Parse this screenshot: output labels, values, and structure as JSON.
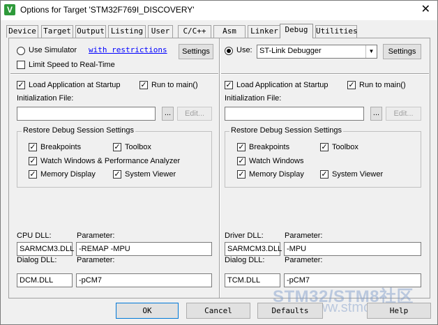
{
  "window": {
    "title": "Options for Target 'STM32F769I_DISCOVERY'",
    "close_glyph": "✕",
    "app_icon_glyph": "V"
  },
  "tabs": [
    {
      "label": "Device"
    },
    {
      "label": "Target"
    },
    {
      "label": "Output"
    },
    {
      "label": "Listing"
    },
    {
      "label": "User"
    },
    {
      "label": "C/C++"
    },
    {
      "label": "Asm"
    },
    {
      "label": "Linker"
    },
    {
      "label": "Debug",
      "active": true
    },
    {
      "label": "Utilities"
    }
  ],
  "left": {
    "use_simulator_label": "Use Simulator",
    "with_restrictions_link": "with restrictions",
    "settings_label": "Settings",
    "limit_speed_label": "Limit Speed to Real-Time",
    "load_app_label": "Load Application at Startup",
    "run_to_main_label": "Run to main()",
    "init_file_label": "Initialization File:",
    "init_file_value": "",
    "browse_label": "...",
    "edit_label": "Edit...",
    "restore_group_title": "Restore Debug Session Settings",
    "breakpoints_label": "Breakpoints",
    "toolbox_label": "Toolbox",
    "watch_windows_label": "Watch Windows & Performance Analyzer",
    "memory_display_label": "Memory Display",
    "system_viewer_label": "System Viewer",
    "cpu_dll_label": "CPU DLL:",
    "cpu_param_label": "Parameter:",
    "cpu_dll_value": "SARMCM3.DLL",
    "cpu_param_value": "-REMAP -MPU",
    "dialog_dll_label": "Dialog DLL:",
    "dialog_param_label": "Parameter:",
    "dialog_dll_value": "DCM.DLL",
    "dialog_param_value": "-pCM7"
  },
  "right": {
    "use_label": "Use:",
    "debugger_selected": "ST-Link Debugger",
    "settings_label": "Settings",
    "load_app_label": "Load Application at Startup",
    "run_to_main_label": "Run to main()",
    "init_file_label": "Initialization File:",
    "init_file_value": "",
    "browse_label": "...",
    "edit_label": "Edit...",
    "restore_group_title": "Restore Debug Session Settings",
    "breakpoints_label": "Breakpoints",
    "toolbox_label": "Toolbox",
    "watch_windows_label": "Watch Windows",
    "memory_display_label": "Memory Display",
    "system_viewer_label": "System Viewer",
    "driver_dll_label": "Driver DLL:",
    "driver_param_label": "Parameter:",
    "driver_dll_value": "SARMCM3.DLL",
    "driver_param_value": "-MPU",
    "dialog_dll_label": "Dialog DLL:",
    "dialog_param_label": "Parameter:",
    "dialog_dll_value": "TCM.DLL",
    "dialog_param_value": "-pCM7"
  },
  "buttons": {
    "ok": "OK",
    "cancel": "Cancel",
    "defaults": "Defaults",
    "help": "Help"
  },
  "watermark": {
    "line1": "STM32/STM8社区",
    "line2": "www.stmcu.org"
  },
  "check_glyph": "✓",
  "dropdown_glyph": "▼"
}
